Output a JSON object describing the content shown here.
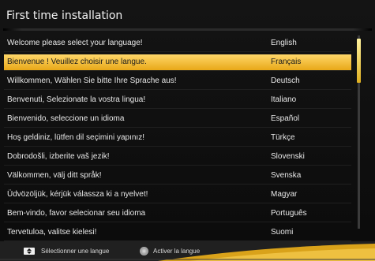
{
  "window": {
    "title": "First time installation"
  },
  "languages": [
    {
      "greeting": "Welcome please select your language!",
      "language": "English"
    },
    {
      "greeting": "Bienvenue ! Veuillez choisir une langue.",
      "language": "Français"
    },
    {
      "greeting": "Willkommen, Wählen Sie bitte Ihre Sprache aus!",
      "language": "Deutsch"
    },
    {
      "greeting": "Benvenuti, Selezionate la vostra lingua!",
      "language": "Italiano"
    },
    {
      "greeting": "Bienvenido, seleccione un idioma",
      "language": "Español"
    },
    {
      "greeting": "Hoş geldiniz, lütfen dil seçimini yapınız!",
      "language": "Türkçe"
    },
    {
      "greeting": "Dobrodošli, izberite vaš jezik!",
      "language": "Slovenski"
    },
    {
      "greeting": "Välkommen, välj ditt språk!",
      "language": "Svenska"
    },
    {
      "greeting": "Üdvözöljük, kérjük válassza ki a nyelvet!",
      "language": "Magyar"
    },
    {
      "greeting": "Bem-vindo, favor selecionar seu idioma",
      "language": "Português"
    },
    {
      "greeting": "Tervetuloa, valitse kielesi!",
      "language": "Suomi"
    }
  ],
  "selected_index": 1,
  "footer": {
    "navigate_label": "Sélectionner une langue",
    "confirm_label": "Activer la langue",
    "navigate_icon": "up-down-arrows-icon",
    "confirm_icon": "ok-button-icon"
  },
  "colors": {
    "highlight": "#f0b530",
    "background": "#111111",
    "text": "#e8e8e8"
  }
}
